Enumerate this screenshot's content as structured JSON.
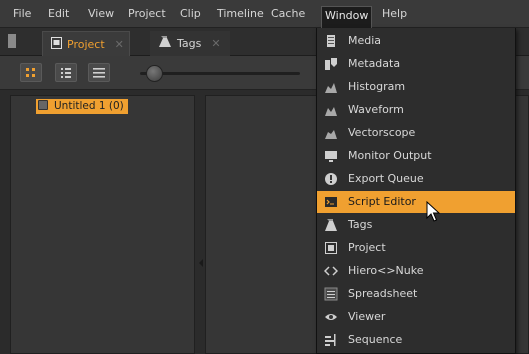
{
  "menubar": {
    "items": [
      "File",
      "Edit",
      "View",
      "Project",
      "Clip",
      "Timeline",
      "Cache",
      "Window",
      "Help"
    ],
    "active": "Window"
  },
  "tabs": [
    {
      "label": "Project",
      "close": "✕",
      "active": true
    },
    {
      "label": "Tags",
      "close": "✕",
      "active": false
    }
  ],
  "project_panel": {
    "bin_label": "Untitled 1 (0)"
  },
  "window_menu": {
    "items": [
      {
        "label": "Media",
        "icon": "media-icon"
      },
      {
        "label": "Metadata",
        "icon": "metadata-icon"
      },
      {
        "label": "Histogram",
        "icon": "histogram-icon"
      },
      {
        "label": "Waveform",
        "icon": "waveform-icon"
      },
      {
        "label": "Vectorscope",
        "icon": "vectorscope-icon"
      },
      {
        "label": "Monitor Output",
        "icon": "monitor-icon"
      },
      {
        "label": "Export Queue",
        "icon": "export-icon"
      },
      {
        "label": "Script Editor",
        "icon": "script-icon",
        "highlighted": true
      },
      {
        "label": "Tags",
        "icon": "tags-icon"
      },
      {
        "label": "Project",
        "icon": "project-icon"
      },
      {
        "label": "Hiero<>Nuke",
        "icon": "hiero-nuke-icon"
      },
      {
        "label": "Spreadsheet",
        "icon": "spreadsheet-icon"
      },
      {
        "label": "Viewer",
        "icon": "viewer-icon"
      },
      {
        "label": "Sequence",
        "icon": "sequence-icon"
      }
    ]
  },
  "colors": {
    "accent": "#f0a030",
    "background": "#2b2b2b",
    "menu_bg": "#2d2d2d"
  }
}
